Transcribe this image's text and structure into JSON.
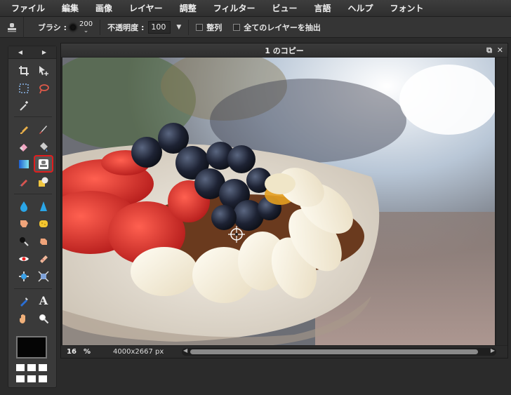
{
  "menu": [
    "ファイル",
    "編集",
    "画像",
    "レイヤー",
    "調整",
    "フィルター",
    "ビュー",
    "言語",
    "ヘルプ",
    "フォント"
  ],
  "options": {
    "brush_label": "ブラシ :",
    "brush_size": "200",
    "opacity_label": "不透明度 :",
    "opacity_value": "100",
    "align_label": "整列",
    "sample_all_label": "全てのレイヤーを抽出"
  },
  "toolbox": {
    "prev_arrow": "◀",
    "next_arrow": "▶",
    "selected_tool": "clone-stamp",
    "text_tool_glyph": "A"
  },
  "document": {
    "title": "1 のコピー",
    "zoom_value": "16",
    "zoom_unit": "%",
    "dimensions": "4000x2667 px"
  }
}
